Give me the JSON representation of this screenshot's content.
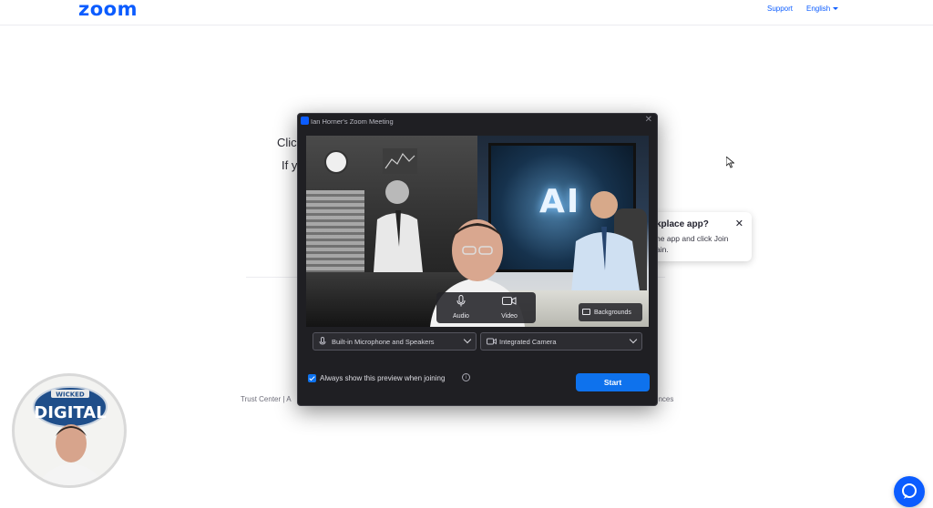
{
  "header": {
    "logo": "zoom",
    "support_label": "Support",
    "language_label": "English"
  },
  "background_page": {
    "line1_fragment": "Clic",
    "line2_fragment": "If y",
    "footer_left": "Trust Center | A",
    "footer_right": "ences"
  },
  "popup": {
    "title": "kplace app?",
    "body": "he app and click Join ain."
  },
  "dialog": {
    "title": "Ian Horner's Zoom Meeting",
    "preview": {
      "ai_text": "AI",
      "audio_label": "Audio",
      "video_label": "Video",
      "backgrounds_label": "Backgrounds"
    },
    "audio_device": "Built-in Microphone and Speakers",
    "video_device": "Integrated Camera",
    "checkbox_label": "Always show this preview when joining",
    "checkbox_checked": true,
    "start_label": "Start"
  },
  "webcam": {
    "badge_top": "WICKED",
    "badge_main": "DIGITAL"
  },
  "colors": {
    "brand": "#0b5cff",
    "start_button": "#0e72ed",
    "dialog_bg": "#1f1f23"
  }
}
